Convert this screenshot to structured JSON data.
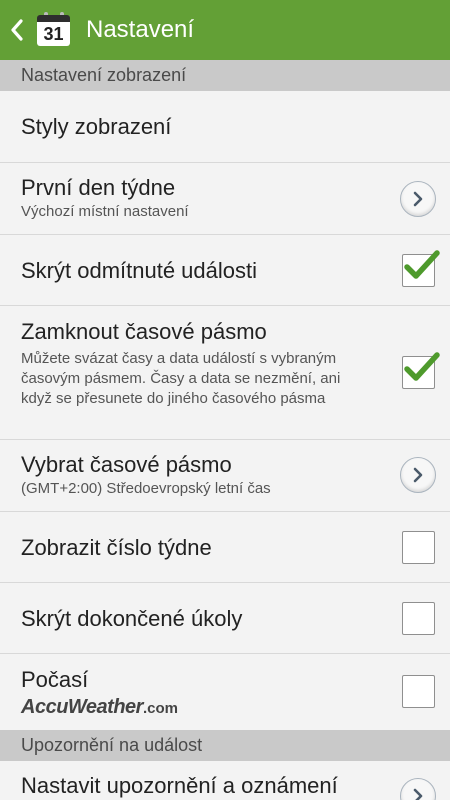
{
  "header": {
    "calendar_day": "31",
    "title": "Nastavení"
  },
  "sections": [
    {
      "title": "Nastavení zobrazení"
    },
    {
      "title": "Upozornění na událost"
    }
  ],
  "items": [
    {
      "title": "Styly zobrazení"
    },
    {
      "title": "První den týdne",
      "subtitle": "Výchozí místní nastavení"
    },
    {
      "title": "Skrýt odmítnuté události",
      "checked": true
    },
    {
      "title": "Zamknout časové pásmo",
      "subtitle": "Můžete svázat časy a data událostí s vybraným časovým pásmem. Časy a data se nezmění, ani když se přesunete do jiného časového pásma",
      "checked": true
    },
    {
      "title": "Vybrat časové pásmo",
      "subtitle": "(GMT+2:00) Středoevropský letní čas"
    },
    {
      "title": "Zobrazit číslo týdne",
      "checked": false
    },
    {
      "title": "Skrýt dokončené úkoly",
      "checked": false
    },
    {
      "title": "Počasí",
      "logo_main": "AccuWeather",
      "logo_suffix": ".com",
      "checked": false
    },
    {
      "title": "Nastavit upozornění a oznámení"
    }
  ],
  "colors": {
    "action_bar": "#63a036",
    "check_mark": "#4e9a2c"
  },
  "icons": {
    "back": "back-arrow-icon",
    "app": "calendar-app-icon",
    "chevron": "chevron-right-icon",
    "check": "check-mark-icon"
  }
}
